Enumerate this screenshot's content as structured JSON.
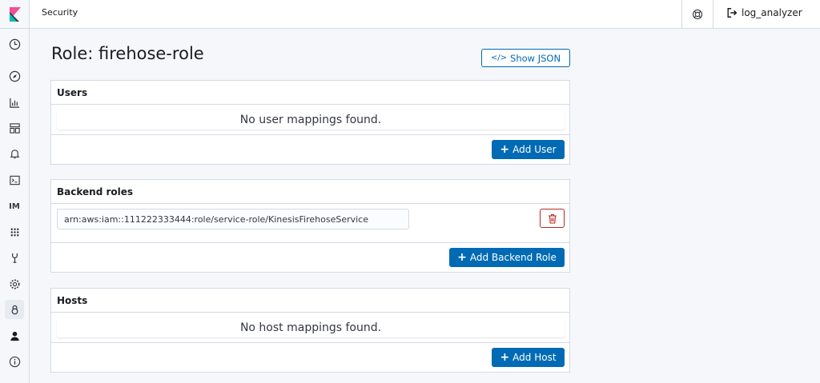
{
  "header": {
    "app_title": "Security",
    "user_name": "log_analyzer"
  },
  "sidebar": {
    "items": [
      {
        "icon": "clock-icon"
      },
      {
        "icon": "compass-icon"
      },
      {
        "icon": "visualize-icon"
      },
      {
        "icon": "dashboard-icon"
      },
      {
        "icon": "alert-bell-icon"
      },
      {
        "icon": "console-icon"
      },
      {
        "label": "IM"
      },
      {
        "icon": "grid-icon"
      },
      {
        "icon": "devtools-icon"
      },
      {
        "icon": "gear-icon"
      },
      {
        "icon": "security-lock-icon",
        "active": true
      },
      {
        "icon": "user-icon"
      },
      {
        "icon": "info-icon"
      }
    ]
  },
  "page": {
    "title": "Role: firehose-role",
    "show_json_label": "Show JSON"
  },
  "users": {
    "heading": "Users",
    "empty_text": "No user mappings found.",
    "add_label": "Add User"
  },
  "backend_roles": {
    "heading": "Backend roles",
    "values": [
      "arn:aws:iam::111222333444:role/service-role/KinesisFirehoseService"
    ],
    "add_label": "Add Backend Role"
  },
  "hosts": {
    "heading": "Hosts",
    "empty_text": "No host mappings found.",
    "add_label": "Add Host"
  },
  "colors": {
    "primary": "#006bb4",
    "danger": "#bd271e",
    "border": "#d3dae6"
  }
}
